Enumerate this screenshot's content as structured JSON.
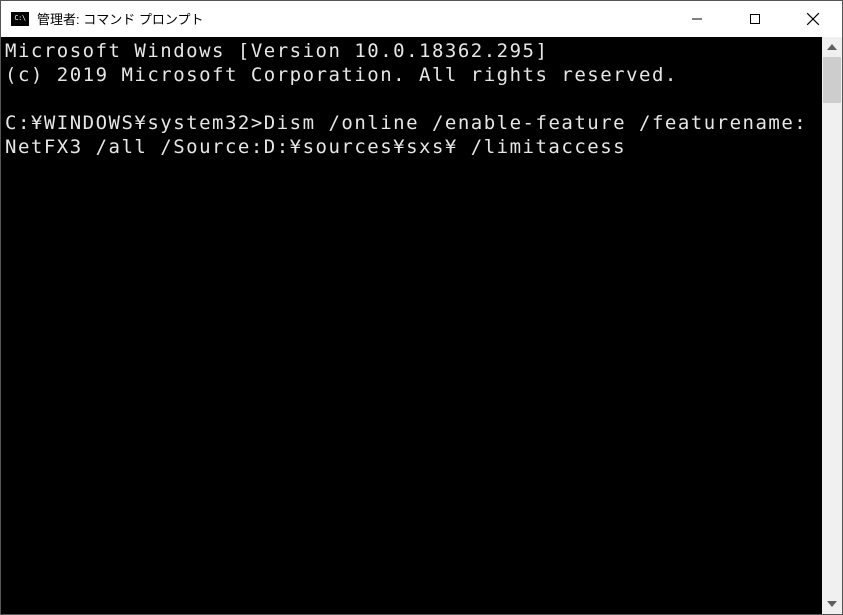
{
  "window": {
    "title": "管理者: コマンド プロンプト",
    "icon_label": "C:\\"
  },
  "terminal": {
    "version_line": "Microsoft Windows [Version 10.0.18362.295]",
    "copyright_line": "(c) 2019 Microsoft Corporation. All rights reserved.",
    "prompt": "C:¥WINDOWS¥system32>",
    "command": "Dism /online /enable-feature /featurename:NetFX3 /all /Source:D:¥sources¥sxs¥ /limitaccess"
  }
}
